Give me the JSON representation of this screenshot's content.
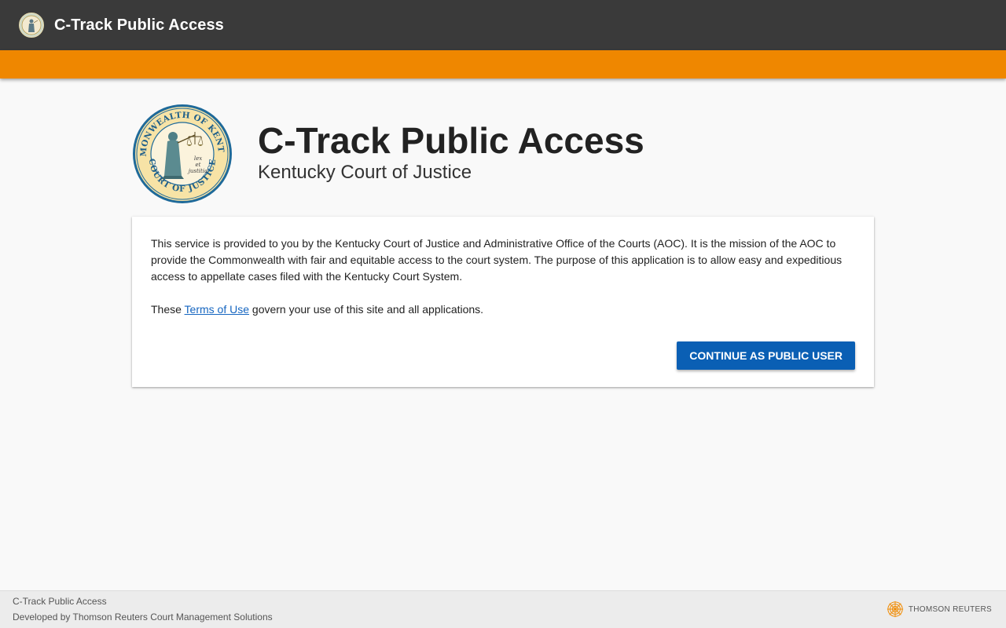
{
  "header": {
    "title": "C-Track Public Access",
    "logo_icon": "kentucky-seal-icon"
  },
  "hero": {
    "title": "C-Track Public Access",
    "subtitle": "Kentucky Court of Justice",
    "seal_text_top": "COMMONWEALTH OF KENTUCKY",
    "seal_text_bottom": "COURT OF JUSTICE",
    "seal_motto": "lex et justitia"
  },
  "card": {
    "intro": "This service is provided to you by the Kentucky Court of Justice and Administrative Office of the Courts (AOC). It is the mission of the AOC to provide the Commonwealth with fair and equitable access to the court system. The purpose of this application is to allow easy and expeditious access to appellate cases filed with the Kentucky Court System.",
    "terms_prefix": "These ",
    "terms_link": "Terms of Use",
    "terms_suffix": " govern your use of this site and all applications.",
    "continue_button": "CONTINUE AS PUBLIC USER"
  },
  "footer": {
    "line1": "C-Track Public Access",
    "line2": "Developed by Thomson Reuters Court Management Solutions",
    "brand": "THOMSON REUTERS"
  },
  "colors": {
    "topbar": "#3a3a3a",
    "orange": "#ef8700",
    "button": "#0a5fb4",
    "link": "#1565c0"
  }
}
